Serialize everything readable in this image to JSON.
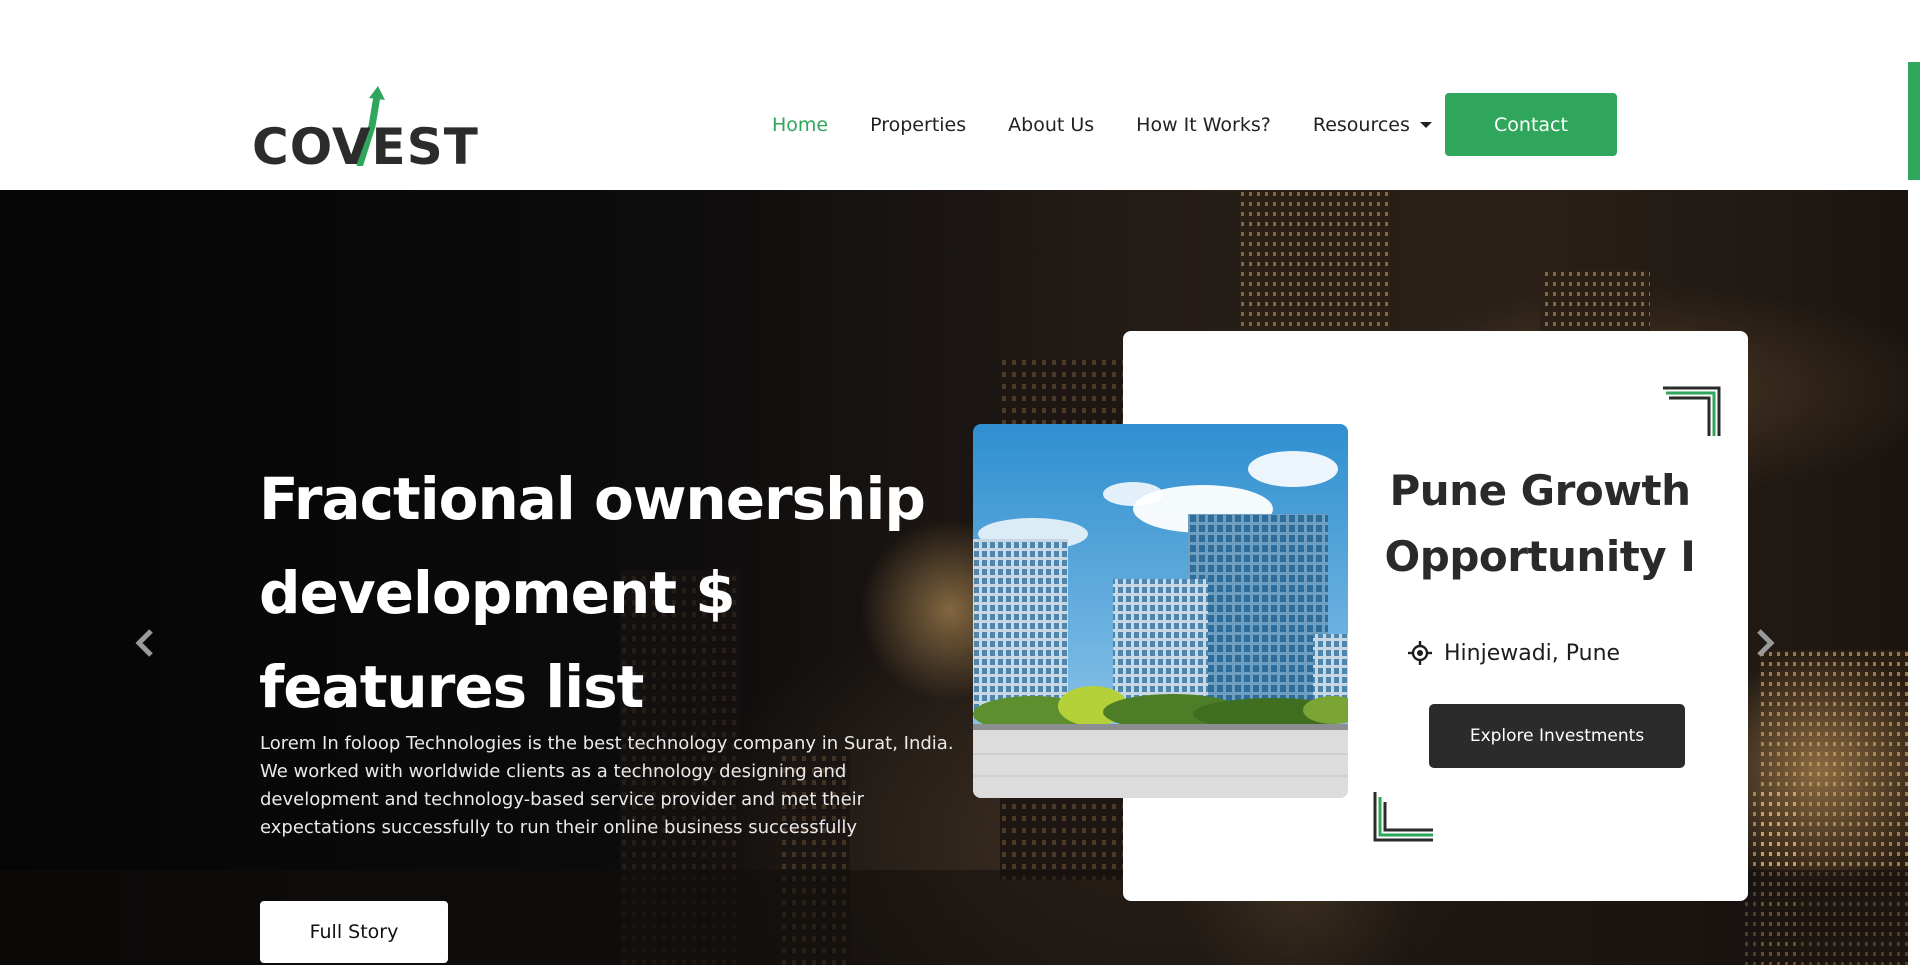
{
  "brand": {
    "logo_text": "COVEST",
    "accent_color": "#2fa65b",
    "dark_color": "#2c2c2c"
  },
  "nav": {
    "items": [
      {
        "label": "Home",
        "active": true
      },
      {
        "label": "Properties",
        "active": false
      },
      {
        "label": "About Us",
        "active": false
      },
      {
        "label": "How It Works?",
        "active": false
      },
      {
        "label": "Resources",
        "active": false,
        "dropdown": true
      }
    ],
    "contact_label": "Contact"
  },
  "hero": {
    "title_lines": [
      "Fractional ownership",
      "development $",
      "features list"
    ],
    "description": "Lorem In foloop Technologies is the best technology company in Surat, India. We worked with worldwide clients as a technology designing and development and technology-based service provider and met their expectations successfully to run their online business successfully",
    "cta_label": "Full Story",
    "prev_icon": "chevron-left-icon",
    "next_icon": "chevron-right-icon"
  },
  "property": {
    "title_line1": "Pune Growth",
    "title_line2": "Opportunity I",
    "location": "Hinjewadi, Pune",
    "location_icon": "crosshair-location-icon",
    "cta_label": "Explore Investments"
  }
}
